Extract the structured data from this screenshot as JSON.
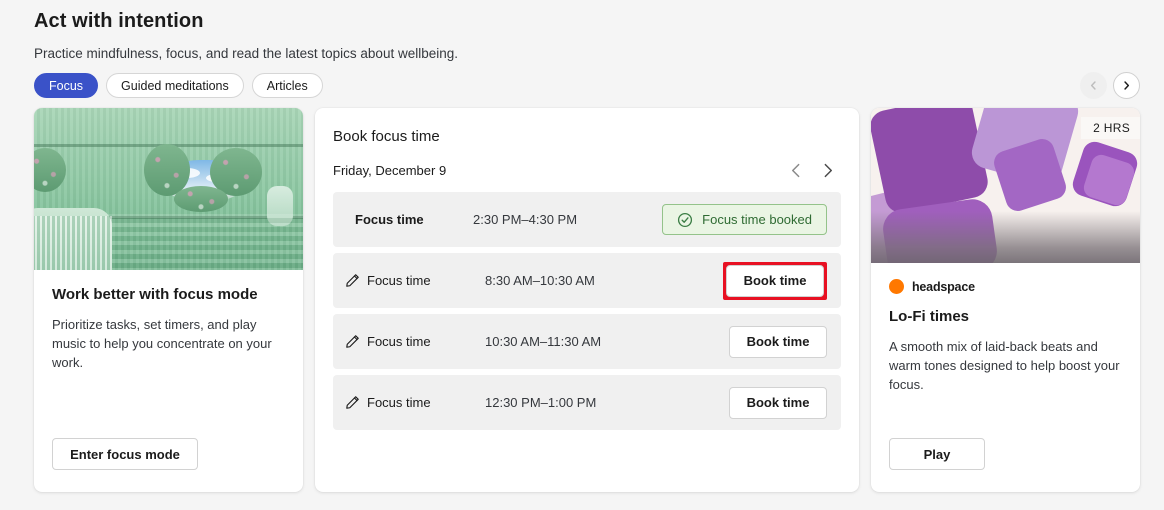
{
  "header": {
    "title": "Act with intention",
    "subtitle": "Practice mindfulness, focus, and read the latest topics about wellbeing.",
    "tabs": [
      {
        "label": "Focus",
        "active": true
      },
      {
        "label": "Guided meditations",
        "active": false
      },
      {
        "label": "Articles",
        "active": false
      }
    ],
    "carousel": {
      "prev_icon": "chevron-left-icon",
      "next_icon": "chevron-right-icon",
      "prev_enabled": false,
      "next_enabled": true
    }
  },
  "focus_card": {
    "image_alt": "green-room-illustration",
    "title": "Work better with focus mode",
    "text": "Prioritize tasks, set timers, and play music to help you concentrate on your work.",
    "button_label": "Enter focus mode"
  },
  "book_card": {
    "title": "Book focus time",
    "date": "Friday, December 9",
    "prev_day_icon": "chevron-left-icon",
    "next_day_icon": "chevron-right-icon",
    "slots": [
      {
        "label": "Focus time",
        "time": "2:30 PM–4:30 PM",
        "state": "booked",
        "status_label": "Focus time booked",
        "status_icon": "check-circle-icon",
        "has_edit_icon": false,
        "highlighted": false
      },
      {
        "label": "Focus time",
        "time": "8:30 AM–10:30 AM",
        "state": "available",
        "action_label": "Book time",
        "has_edit_icon": true,
        "highlighted": true
      },
      {
        "label": "Focus time",
        "time": "10:30 AM–11:30 AM",
        "state": "available",
        "action_label": "Book time",
        "has_edit_icon": true,
        "highlighted": false
      },
      {
        "label": "Focus time",
        "time": "12:30 PM–1:00 PM",
        "state": "available",
        "action_label": "Book time",
        "has_edit_icon": true,
        "highlighted": false
      }
    ]
  },
  "media_card": {
    "duration_badge": "2 HRS",
    "brand": "headspace",
    "title": "Lo-Fi times",
    "text": "A smooth mix of laid-back beats and warm tones designed to help boost your focus.",
    "button_label": "Play"
  },
  "colors": {
    "page_background": "#f5f5f5",
    "accent_blue": "#3a52c8",
    "highlight_red": "#e81123",
    "booked_green_text": "#2f6b33",
    "booked_green_bg": "#eaf5e4",
    "brand_orange": "#ff7800"
  }
}
